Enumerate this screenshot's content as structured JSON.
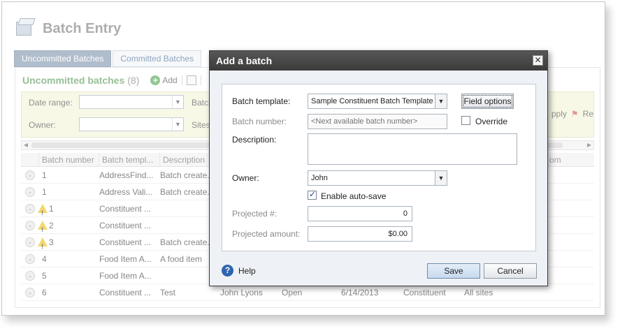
{
  "page": {
    "title": "Batch Entry"
  },
  "tabs": [
    {
      "label": "Uncommitted Batches",
      "active": true
    },
    {
      "label": "Committed Batches",
      "active": false
    }
  ],
  "section": {
    "title": "Uncommitted batches",
    "count": "(8)",
    "add_label": "Add"
  },
  "filters": {
    "date_range_label": "Date range:",
    "owner_label": "Owner:",
    "batch_label": "Batch",
    "sites_label": "Sites:",
    "apply_label": "pply",
    "reset_label": "Re"
  },
  "grid": {
    "columns": [
      "Batch number",
      "Batch templ...",
      "Description"
    ],
    "trailing_header": "om",
    "rows": [
      {
        "warn": false,
        "number": "1",
        "template": "AddressFind...",
        "description": "Batch create.",
        "owner": "",
        "status": "",
        "date": "",
        "type": "",
        "sites": ""
      },
      {
        "warn": false,
        "number": "1",
        "template": "Address Vali...",
        "description": "Batch create.",
        "owner": "",
        "status": "",
        "date": "",
        "type": "",
        "sites": ""
      },
      {
        "warn": true,
        "number": "1",
        "template": "Constituent ...",
        "description": "",
        "owner": "",
        "status": "",
        "date": "",
        "type": "",
        "sites": ""
      },
      {
        "warn": true,
        "number": "2",
        "template": "Constituent ...",
        "description": "",
        "owner": "",
        "status": "",
        "date": "",
        "type": "",
        "sites": ""
      },
      {
        "warn": true,
        "number": "3",
        "template": "Constituent ...",
        "description": "Batch create.",
        "owner": "",
        "status": "",
        "date": "",
        "type": "",
        "sites": ""
      },
      {
        "warn": false,
        "number": "4",
        "template": "Food Item A...",
        "description": "A food item",
        "owner": "",
        "status": "",
        "date": "",
        "type": "",
        "sites": ""
      },
      {
        "warn": false,
        "number": "5",
        "template": "Food Item A...",
        "description": "",
        "owner": "",
        "status": "",
        "date": "",
        "type": "",
        "sites": ""
      },
      {
        "warn": false,
        "number": "6",
        "template": "Constituent ...",
        "description": "Test",
        "owner": "John Lyons",
        "status": "Open",
        "date": "6/14/2013",
        "type": "Constituent",
        "sites": "All sites"
      }
    ]
  },
  "dialog": {
    "title": "Add a batch",
    "close_glyph": "✕",
    "batch_template_label": "Batch template:",
    "batch_template_value": "Sample Constituent Batch Template",
    "field_options_label": "Field options",
    "batch_number_label": "Batch number:",
    "batch_number_placeholder": "<Next available batch number>",
    "override_label": "Override",
    "description_label": "Description:",
    "description_value": "",
    "owner_label": "Owner:",
    "owner_value": "John",
    "autosave_label": "Enable auto-save",
    "autosave_checked": true,
    "override_checked": false,
    "projected_count_label": "Projected #:",
    "projected_count_value": "0",
    "projected_amount_label": "Projected amount:",
    "projected_amount_value": "$0.00",
    "help_label": "Help",
    "save_label": "Save",
    "cancel_label": "Cancel"
  },
  "icons": {
    "app": "batch-entry-box-icon",
    "add": "plus-circle-icon",
    "warning": "warning-triangle-icon",
    "expand": "chevron-circle-icon",
    "help": "question-circle-icon"
  },
  "colors": {
    "accent_green": "#3f8a3f",
    "active_tab": "#6f87a3",
    "dialog_titlebar": "#3b3b3b",
    "warning": "#e8b900",
    "help_blue": "#2f64b0"
  }
}
